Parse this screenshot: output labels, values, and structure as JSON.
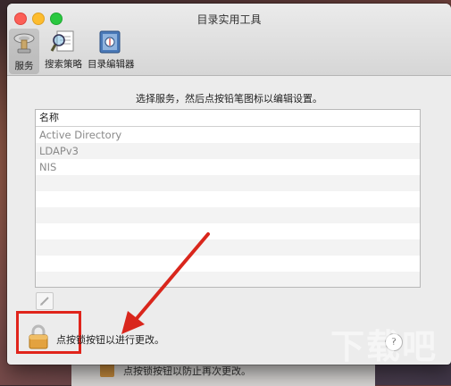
{
  "window": {
    "title": "目录实用工具"
  },
  "toolbar": [
    {
      "label": "服务",
      "icon": "services-icon",
      "active": true
    },
    {
      "label": "搜索策略",
      "icon": "search-policy-icon",
      "active": false
    },
    {
      "label": "目录编辑器",
      "icon": "directory-editor-icon",
      "active": false
    }
  ],
  "instruction": "选择服务，然后点按铅笔图标以编辑设置。",
  "table": {
    "header": "名称",
    "rows": [
      "Active Directory",
      "LDAPv3",
      "NIS"
    ]
  },
  "lock": {
    "text": "点按锁按钮以进行更改。"
  },
  "help": {
    "label": "?"
  },
  "background_window": {
    "text": "点按锁按钮以防止再次更改。"
  },
  "watermark": {
    "text": "下载吧"
  },
  "colors": {
    "highlight": "#e0241b",
    "arrow": "#d9261c",
    "close": "#fc5f57",
    "minimize": "#fdbc2e",
    "maximize": "#2ac840"
  }
}
